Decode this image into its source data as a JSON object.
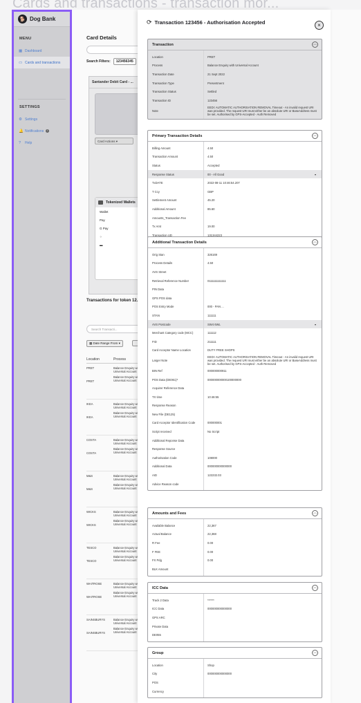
{
  "page_title": "Cards and transactions - transaction mor...",
  "sidebar": {
    "brand": "Dog Bank",
    "menu_heading": "MENU",
    "menu_items": [
      {
        "label": "Dashboard",
        "icon": "grid-icon",
        "active": false
      },
      {
        "label": "Cards and transactions",
        "icon": "card-icon",
        "active": true
      }
    ],
    "settings_heading": "SETTINGS",
    "settings_items": [
      {
        "label": "Settings",
        "icon": "gear-icon"
      },
      {
        "label": "Notifications",
        "icon": "bell-icon",
        "badge": "i"
      },
      {
        "label": "Help",
        "icon": "help-icon"
      }
    ]
  },
  "main": {
    "card_details_title": "Card Details",
    "search_filters_label": "Search Filters:",
    "filter_chip": "123456345",
    "debit_card_title": "Santander Debit Card - ...",
    "card_actions_label": "Card Actions",
    "tokenized_wallets_title": "Tokenized Wallets",
    "wallets": [
      "Wallet",
      "Pay",
      "G Pay",
      "",
      ""
    ],
    "transactions_title": "Transactions for token 12...",
    "tx_search_placeholder": "Search Transacti...",
    "date_range_label": "Date Range From",
    "columns": [
      "Location",
      "Process"
    ],
    "rows": [
      {
        "location": "PRET",
        "process": "Balance Enquiry with Universal Account",
        "location2": "PRET",
        "process2": "Balance Enquiry with Universal Account"
      },
      {
        "location": "IKEA",
        "process": "Balance Enquiry with Universal Account",
        "location2": "IKEA",
        "process2": "Balance Enquiry with Universal Account"
      },
      {
        "location": "COSTA",
        "process": "Balance Enquiry with Universal Account",
        "location2": "COSTA",
        "process2": "Balance Enquiry with Universal Account"
      },
      {
        "location": "M&S",
        "process": "Balance Enquiry with Universal Account",
        "location2": "M&S",
        "process2": "Balance Enquiry with Universal Account"
      },
      {
        "location": "WICKS",
        "process": "Balance Enquiry with Universal Account",
        "location2": "WICKS",
        "process2": "Balance Enquiry with Universal Account"
      },
      {
        "location": "TESCO",
        "process": "Balance Enquiry with Universal Account",
        "location2": "TESCO",
        "process2": "Balance Enquiry with Universal Account"
      },
      {
        "location": "WAITROSE",
        "process": "Balance Enquiry with Universal Account",
        "location2": "WAITROSE",
        "process2": "Balance Enquiry with Universal Account"
      },
      {
        "location": "SAINSBURYS",
        "process": "Balance Enquiry with Universal Account",
        "location2": "SAINSBURYS",
        "process2": "Balance Enquiry with Universal Account"
      }
    ]
  },
  "drawer": {
    "title": "Transaction 123456 - Authorisation Accepted",
    "sections": [
      {
        "title": "Transaction",
        "gray": true,
        "rows": [
          {
            "label": "Location",
            "value": "PRET"
          },
          {
            "label": "Process",
            "value": "Balance Enquiry with Universal Account"
          },
          {
            "label": "Transaction Date",
            "value": "21 Sept 2022"
          },
          {
            "label": "Transaction Type",
            "value": "Presentment"
          },
          {
            "label": "Transaction Status",
            "value": "Settled"
          },
          {
            "label": "Transaction ID",
            "value": "123456"
          },
          {
            "label": "Note",
            "value": "EEDI: AUTOMATIC AUTHORISATION REMOVAL Timeout - An invalid request URI was provided. The request URI must either be an absolute URI or BaseAddress must be set. Authorised by GPS-Accepted - Auth Removed"
          }
        ]
      },
      {
        "title": "Primary Transaction Details",
        "rows": [
          {
            "label": "Billing Amount",
            "value": "4.50"
          },
          {
            "label": "Transaction Amount",
            "value": "4.50"
          },
          {
            "label": "Status",
            "value": "Accepted"
          },
          {
            "label": "Response Status",
            "value": "00 - All Good",
            "highlight": true
          },
          {
            "label": "TxDATE",
            "value": "2022-08-11 10:46:54.207"
          },
          {
            "label": "T Ccy",
            "value": "GBP"
          },
          {
            "label": "Settlement Amount",
            "value": "45.20"
          },
          {
            "label": "Additional Amount",
            "value": "85.60"
          },
          {
            "label": "Amounts_Transaction Fee",
            "value": ""
          },
          {
            "label": "Tx Amt",
            "value": "19.00"
          },
          {
            "label": "Transaction UD",
            "value": "131344223"
          }
        ]
      },
      {
        "title": "Additional Transaction Details",
        "rows": [
          {
            "label": "Orig Stan",
            "value": "326169"
          },
          {
            "label": "Process Details",
            "value": "4.50"
          },
          {
            "label": "AVS Street",
            "value": ""
          },
          {
            "label": "Retrieval Reference Number",
            "value": "0111111111111"
          },
          {
            "label": "PIN Data",
            "value": ""
          },
          {
            "label": "GPS POS data",
            "value": ""
          },
          {
            "label": "POS Entry Mode",
            "value": "000 - PAN ..."
          },
          {
            "label": "STAN",
            "value": "111111"
          },
          {
            "label": "AVS Postcode",
            "value": "SW4 6WL",
            "highlight": true
          },
          {
            "label": "Merchant Category code (MCC)",
            "value": "111112"
          },
          {
            "label": "FID",
            "value": "211111"
          },
          {
            "label": "Card Acceptor Name Location",
            "value": "DUTY FREE SHOPS"
          },
          {
            "label": "Larger Note",
            "value": "EEDI: AUTOMATIC AUTHORISATION REMOVAL Timeout - An invalid request URI was provided. The request URI must either be an absolute URI or BaseAddress must be set. Authorised by GPS-Accepted - Auth Removed"
          },
          {
            "label": "BIN Ref",
            "value": "000000000911"
          },
          {
            "label": "POS Data (DE061)*",
            "value": "000000000000100000000"
          },
          {
            "label": "Acquirer Reference Data",
            "value": ""
          },
          {
            "label": "TX time",
            "value": "10:46:55"
          },
          {
            "label": "Response Reason",
            "value": ""
          },
          {
            "label": "New File (DE125)",
            "value": ""
          },
          {
            "label": "Card Acceptor Identification Code",
            "value": "000000001"
          },
          {
            "label": "Script received",
            "value": "No Script"
          },
          {
            "label": "Additional Reponse Data",
            "value": ""
          },
          {
            "label": "Response Source",
            "value": ""
          },
          {
            "label": "Authorisation Code",
            "value": "108000"
          },
          {
            "label": "Additional Data",
            "value": "000000000000000"
          },
          {
            "label": "AID",
            "value": "122232.03"
          },
          {
            "label": "Advice Reason code",
            "value": ""
          }
        ]
      },
      {
        "title": "Amounts and Fees",
        "rows": [
          {
            "label": "Available Balance",
            "value": "22,367"
          },
          {
            "label": "Actual Balance",
            "value": "22,368"
          },
          {
            "label": "R Fee",
            "value": "0.00"
          },
          {
            "label": "F FEE",
            "value": "0.00"
          },
          {
            "label": "FX Pdg",
            "value": "0.00"
          },
          {
            "label": "BLK Amount",
            "value": ""
          }
        ]
      },
      {
        "title": "ICC Data",
        "rows": [
          {
            "label": "Track 2 Data",
            "value": "******"
          },
          {
            "label": "ICC Data",
            "value": "000000000000000"
          },
          {
            "label": "GPS ARC",
            "value": ""
          },
          {
            "label": "Private Data",
            "value": ""
          },
          {
            "label": "DE055",
            "value": ""
          }
        ]
      },
      {
        "title": "Group",
        "rows": [
          {
            "label": "Location",
            "value": "Shop"
          },
          {
            "label": "City",
            "value": "000000000000000"
          },
          {
            "label": "POS",
            "value": ""
          },
          {
            "label": "Currency",
            "value": ""
          }
        ]
      }
    ]
  }
}
